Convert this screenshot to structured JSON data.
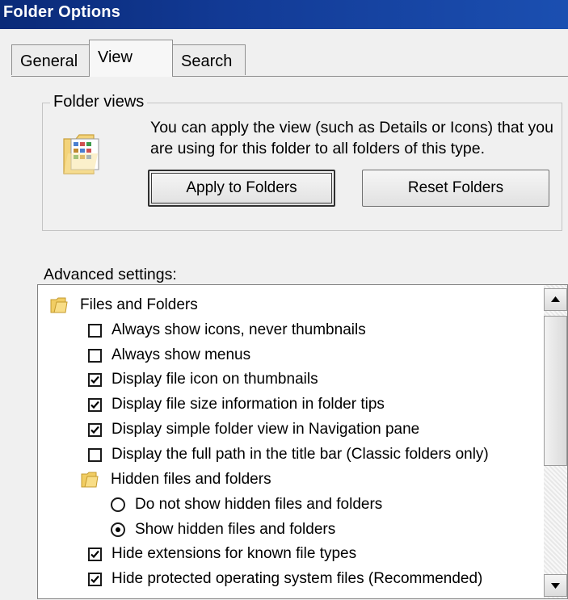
{
  "window": {
    "title": "Folder Options"
  },
  "tabs": [
    {
      "label": "General"
    },
    {
      "label": "View",
      "selected": true
    },
    {
      "label": "Search"
    }
  ],
  "folder_views": {
    "label": "Folder views",
    "description": "You can apply the view (such as Details or Icons) that you are using for this folder to all folders of this type.",
    "apply_button": "Apply to Folders",
    "reset_button": "Reset Folders"
  },
  "advanced": {
    "label": "Advanced settings:",
    "items": [
      {
        "type": "folder",
        "label": "Files and Folders"
      },
      {
        "type": "checkbox",
        "label": "Always show icons, never thumbnails",
        "checked": false
      },
      {
        "type": "checkbox",
        "label": "Always show menus",
        "checked": false
      },
      {
        "type": "checkbox",
        "label": "Display file icon on thumbnails",
        "checked": true
      },
      {
        "type": "checkbox",
        "label": "Display file size information in folder tips",
        "checked": true
      },
      {
        "type": "checkbox",
        "label": "Display simple folder view in Navigation pane",
        "checked": true
      },
      {
        "type": "checkbox",
        "label": "Display the full path in the title bar (Classic folders only)",
        "checked": false
      },
      {
        "type": "folder",
        "label": "Hidden files and folders"
      },
      {
        "type": "radio",
        "label": "Do not show hidden files and folders",
        "selected": false
      },
      {
        "type": "radio",
        "label": "Show hidden files and folders",
        "selected": true
      },
      {
        "type": "checkbox",
        "label": "Hide extensions for known file types",
        "checked": true
      },
      {
        "type": "checkbox",
        "label": "Hide protected operating system files (Recommended)",
        "checked": true
      }
    ]
  },
  "colors": {
    "titlebar": "#0a2a78",
    "face": "#f0f0f0"
  }
}
